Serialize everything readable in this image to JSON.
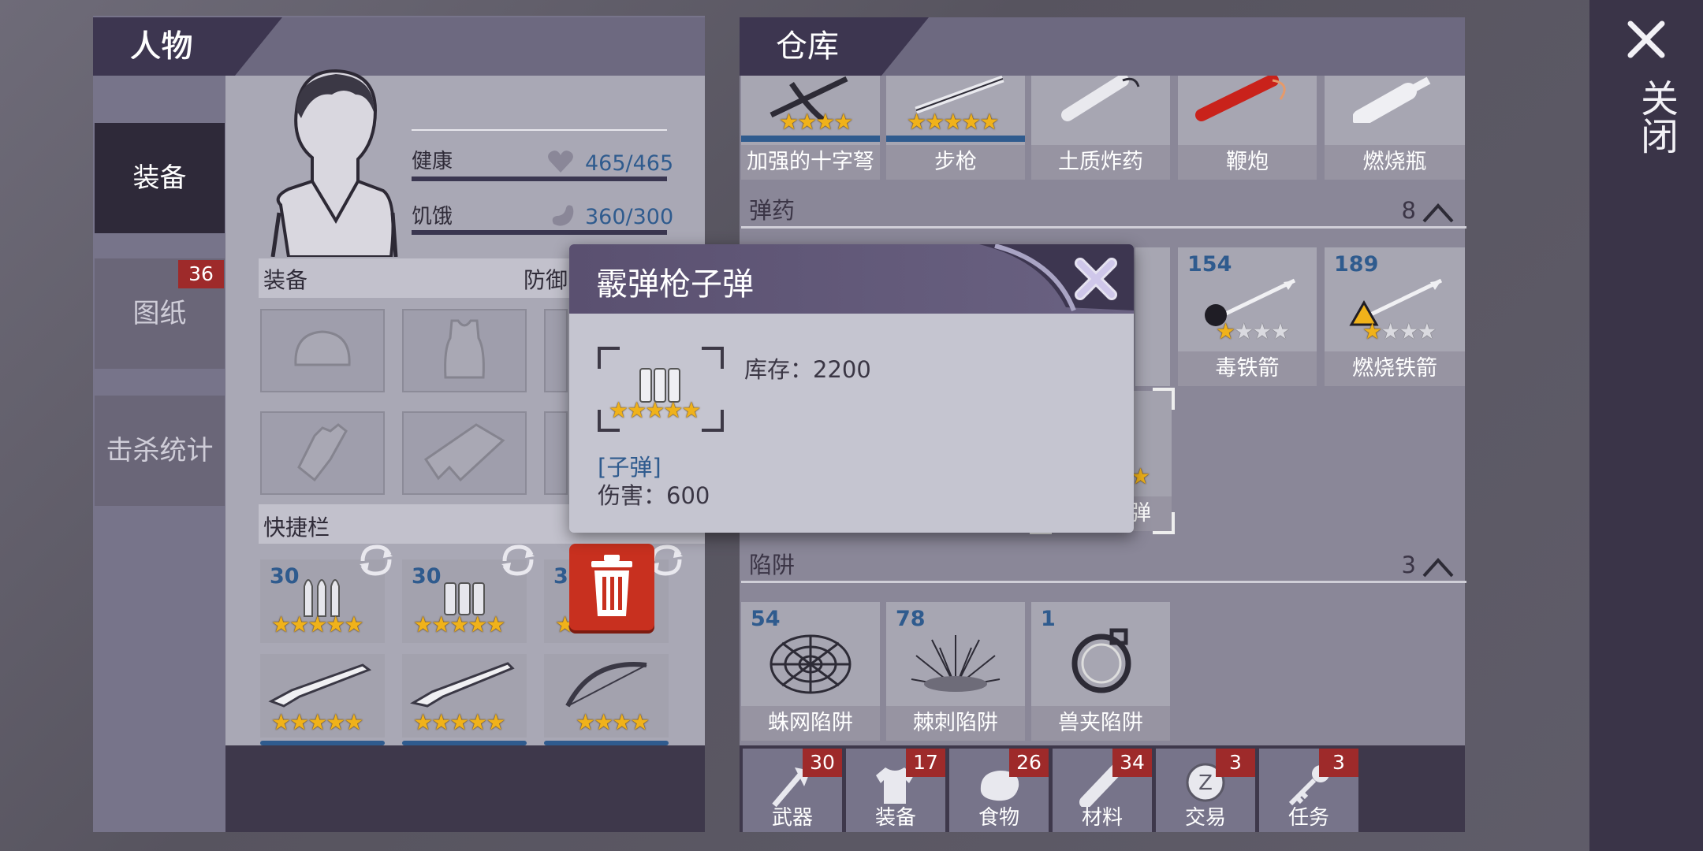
{
  "left_panel": {
    "title": "人物",
    "tabs": [
      {
        "label": "装备"
      },
      {
        "label": "图纸",
        "badge": "36"
      },
      {
        "label": "击杀统计"
      }
    ],
    "stats": [
      {
        "label": "健康",
        "value": "465/465",
        "icon": "heart-icon"
      },
      {
        "label": "饥饿",
        "value": "360/300",
        "icon": "stomach-icon"
      }
    ],
    "equip_section": "装备",
    "defense_label": "防御",
    "quickbar_label": "快捷栏",
    "quickbar": [
      {
        "count": "30",
        "stars": 5
      },
      {
        "count": "30",
        "stars": 5
      },
      {
        "count": "30",
        "stars": 5
      },
      {
        "count": "",
        "stars": 5
      },
      {
        "count": "",
        "stars": 5
      },
      {
        "count": "",
        "stars": 4
      }
    ]
  },
  "warehouse": {
    "title": "仓库",
    "weapons_row": [
      {
        "label": "加强的十字弩",
        "stars": 4
      },
      {
        "label": "步枪",
        "stars": 5
      },
      {
        "label": "土质炸药",
        "stars": 0
      },
      {
        "label": "鞭炮",
        "stars": 0
      },
      {
        "label": "燃烧瓶",
        "stars": 0
      }
    ],
    "ammo_section": {
      "label": "弹药",
      "count": "8"
    },
    "ammo_visible": [
      {
        "count": "154",
        "label": "毒铁箭",
        "stars": 1
      },
      {
        "count": "189",
        "label": "燃烧铁箭",
        "stars": 1
      }
    ],
    "ammo_partial_label": "弹",
    "traps_section": {
      "label": "陷阱",
      "count": "3"
    },
    "traps": [
      {
        "count": "54",
        "label": "蛛网陷阱"
      },
      {
        "count": "78",
        "label": "棘刺陷阱"
      },
      {
        "count": "1",
        "label": "兽夹陷阱"
      }
    ],
    "categories": [
      {
        "label": "武器",
        "badge": "30",
        "icon": "axe-icon"
      },
      {
        "label": "装备",
        "badge": "17",
        "icon": "shirt-icon"
      },
      {
        "label": "食物",
        "badge": "26",
        "icon": "meat-icon"
      },
      {
        "label": "材料",
        "badge": "34",
        "icon": "log-icon"
      },
      {
        "label": "交易",
        "badge": "3",
        "icon": "coin-icon"
      },
      {
        "label": "任务",
        "badge": "3",
        "icon": "key-icon"
      }
    ]
  },
  "close_label": "关闭",
  "popup": {
    "title": "霰弹枪子弹",
    "stock_label": "库存：2200",
    "type_label": "[子弹]",
    "damage_label": "伤害：600",
    "stars": 5
  },
  "colors": {
    "header": "#3d3650",
    "badge": "#9e2a2a",
    "star": "#f0b21a",
    "delete": "#c8301f"
  }
}
